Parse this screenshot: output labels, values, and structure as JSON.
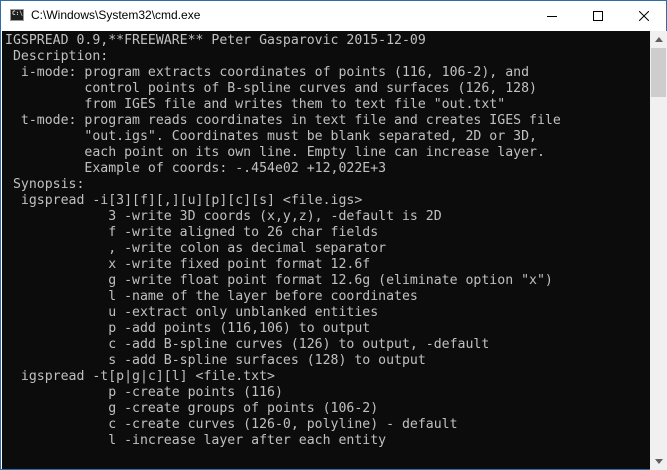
{
  "window": {
    "title": "C:\\Windows\\System32\\cmd.exe",
    "icon": "cmd-icon",
    "icon_text": "C:\\"
  },
  "controls": {
    "minimize": "minimize-icon",
    "maximize": "maximize-icon",
    "close": "close-icon"
  },
  "console": {
    "lines": [
      "IGSPREAD 0.9,**FREEWARE** Peter Gasparovic 2015-12-09",
      " Description:",
      "  i-mode: program extracts coordinates of points (116, 106-2), and",
      "          control points of B-spline curves and surfaces (126, 128)",
      "          from IGES file and writes them to text file \"out.txt\"",
      "  t-mode: program reads coordinates in text file and creates IGES file",
      "          \"out.igs\". Coordinates must be blank separated, 2D or 3D,",
      "          each point on its own line. Empty line can increase layer.",
      "          Example of coords: -.454e02 +12,022E+3",
      " Synopsis:",
      "  igspread -i[3][f][,][u][p][c][s] <file.igs>",
      "             3 -write 3D coords (x,y,z), -default is 2D",
      "             f -write aligned to 26 char fields",
      "             , -write colon as decimal separator",
      "             x -write fixed point format 12.6f",
      "             g -write float point format 12.6g (eliminate option \"x\")",
      "             l -name of the layer before coordinates",
      "             u -extract only unblanked entities",
      "             p -add points (116,106) to output",
      "             c -add B-spline curves (126) to output, -default",
      "             s -add B-spline surfaces (128) to output",
      "  igspread -t[p|g|c][l] <file.txt>",
      "             p -create points (116)",
      "             g -create groups of points (106-2)",
      "             c -create curves (126-0, polyline) - default",
      "             l -increase layer after each entity",
      ""
    ]
  }
}
